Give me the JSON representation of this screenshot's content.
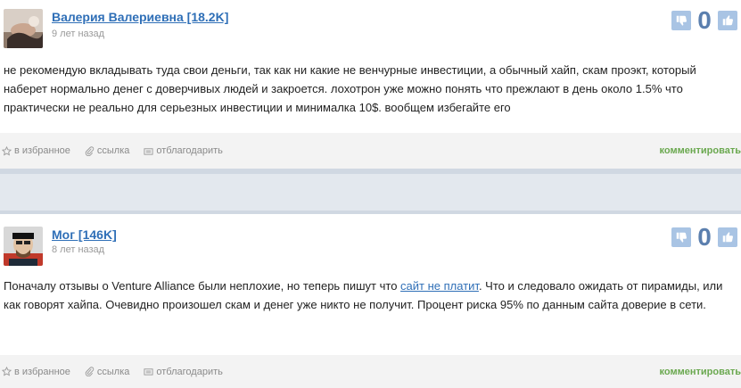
{
  "comments": [
    {
      "author": "Валерия Валериевна [18.2K]",
      "date": "9 лет назад",
      "score": "0",
      "text": "не рекомендую вкладывать туда свои деньги, так как ни какие не венчурные инвестиции, а обычный хайп, скам проэкт, который наберет нормально денег с доверчивых людей и закроется. лохотрон уже можно понять что прежлают в день около 1.5% что практически не реально для серьезных инвестиции и минималка 10$. вообщем избегайте его"
    },
    {
      "author": "Мог [146K]",
      "date": "8 лет назад",
      "score": "0",
      "text_before": "Поначалу отзывы о Venture Alliance были неплохие, но теперь пишут что ",
      "link": "сайт не платит",
      "text_after": ". Что и следовало ожидать от пирамиды, или как говорят хайпа. Очевидно произошел скам и денег уже никто не получит. Процент риска 95% по данным сайта доверие в сети."
    }
  ],
  "actions": {
    "favorite": "в избранное",
    "link": "ссылка",
    "thank": "отблагодарить",
    "comment": "комментировать"
  },
  "colors": {
    "author_link": "#2f6fb7",
    "vote_button": "#a9c4e4",
    "score": "#5b7fae",
    "comment_link": "#6aa84f",
    "actions_bar": "#f3f3f3",
    "separator": "#e3e8ee"
  },
  "icons": {
    "vote_down": "thumbs-down-icon",
    "vote_up": "thumbs-up-icon",
    "favorite": "star-icon",
    "link": "paperclip-icon",
    "thank": "wallet-icon"
  }
}
